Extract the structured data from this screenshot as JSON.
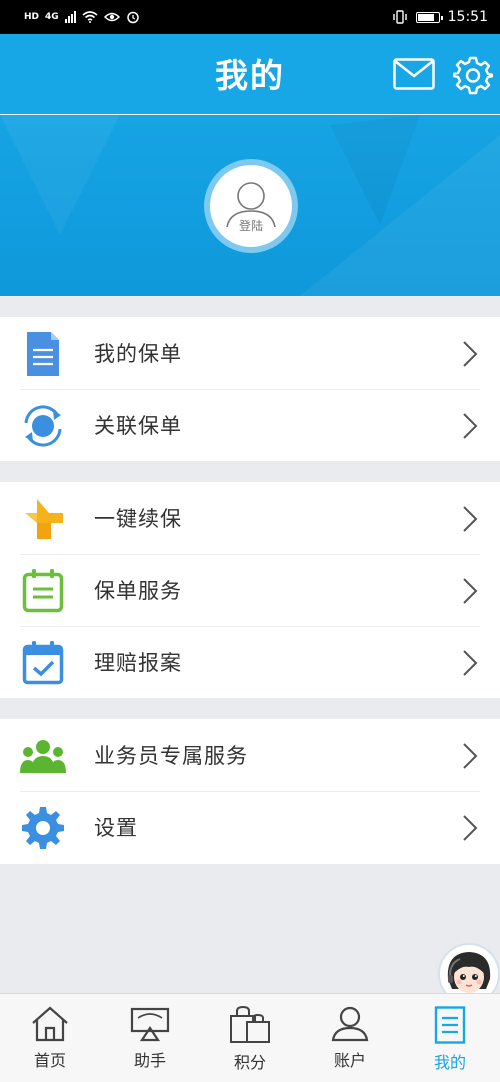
{
  "status_bar": {
    "left_badges": [
      "HD",
      "4G"
    ],
    "time": "15:51"
  },
  "header": {
    "title": "我的",
    "mail_icon": "mail-icon",
    "settings_icon": "gear-icon"
  },
  "profile": {
    "login_label": "登陆"
  },
  "menu": {
    "group1": [
      {
        "label": "我的保单",
        "icon": "document-icon",
        "color": "#4a90e2"
      },
      {
        "label": "关联保单",
        "icon": "link-sync-icon",
        "color": "#3b8fe0"
      }
    ],
    "group2": [
      {
        "label": "一键续保",
        "icon": "renew-icon",
        "color": "#f6b21b"
      },
      {
        "label": "保单服务",
        "icon": "clipboard-icon",
        "color": "#6cbf3c"
      },
      {
        "label": "理赔报案",
        "icon": "calendar-check-icon",
        "color": "#3b8fe0"
      }
    ],
    "group3": [
      {
        "label": "业务员专属服务",
        "icon": "people-icon",
        "color": "#5cb531"
      },
      {
        "label": "设置",
        "icon": "settings-gear-icon",
        "color": "#3b8fe0"
      }
    ]
  },
  "tabbar": [
    {
      "label": "首页",
      "icon": "home-icon",
      "active": false
    },
    {
      "label": "助手",
      "icon": "assistant-icon",
      "active": false
    },
    {
      "label": "积分",
      "icon": "shopping-bag-icon",
      "active": false
    },
    {
      "label": "账户",
      "icon": "user-icon",
      "active": false
    },
    {
      "label": "我的",
      "icon": "list-icon",
      "active": true
    }
  ],
  "colors": {
    "primary": "#17a7e6",
    "background": "#e9ebef",
    "text": "#333333"
  }
}
